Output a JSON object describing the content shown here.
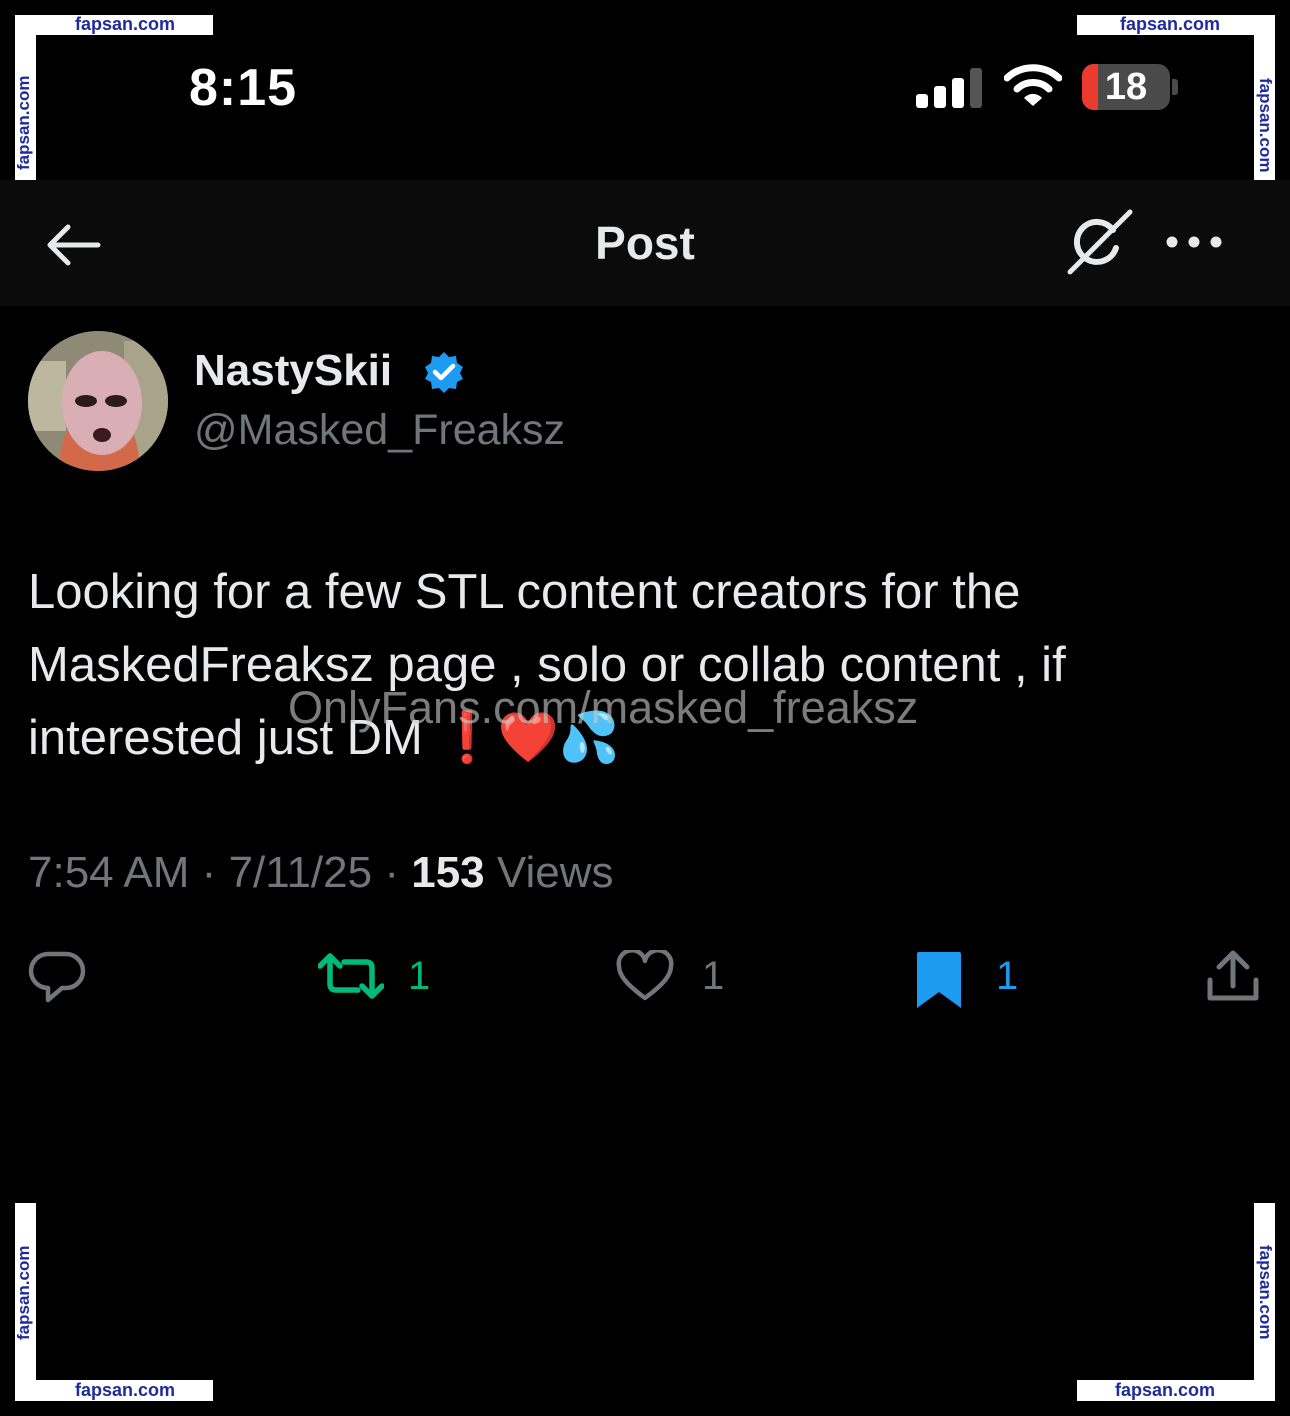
{
  "watermark": {
    "text": "fapsan.com"
  },
  "status_bar": {
    "time": "8:15",
    "battery": "18",
    "battery_level": 0.18,
    "accent_battery": "#ea3b2e"
  },
  "header": {
    "title": "Post"
  },
  "post": {
    "author": {
      "name": "NastySkii",
      "handle": "@Masked_Freaksz",
      "verified": true
    },
    "text_lines": [
      "Looking for a few STL content creators for the",
      "MaskedFreaksz page , solo or collab content , if",
      "interested just DM ❗️❤️💦"
    ],
    "overlay_text": "OnlyFans.com/masked_freaksz",
    "time": "7:54 AM",
    "date": "7/11/25",
    "separator": "·",
    "views_count": "153",
    "views_label": "Views",
    "actions": {
      "reply": {
        "icon": "reply-icon",
        "count": ""
      },
      "repost": {
        "icon": "repost-icon",
        "count": "1",
        "active": true,
        "color": "#00ba7c"
      },
      "like": {
        "icon": "heart-icon",
        "count": "1"
      },
      "bookmark": {
        "icon": "bookmark-icon",
        "count": "1",
        "active": true,
        "color": "#1d9bf0"
      },
      "share": {
        "icon": "share-icon"
      }
    }
  },
  "colors": {
    "verified": "#1d9bf0",
    "secondary_text": "#71767b",
    "watermark_text": "#1f2a9c"
  }
}
